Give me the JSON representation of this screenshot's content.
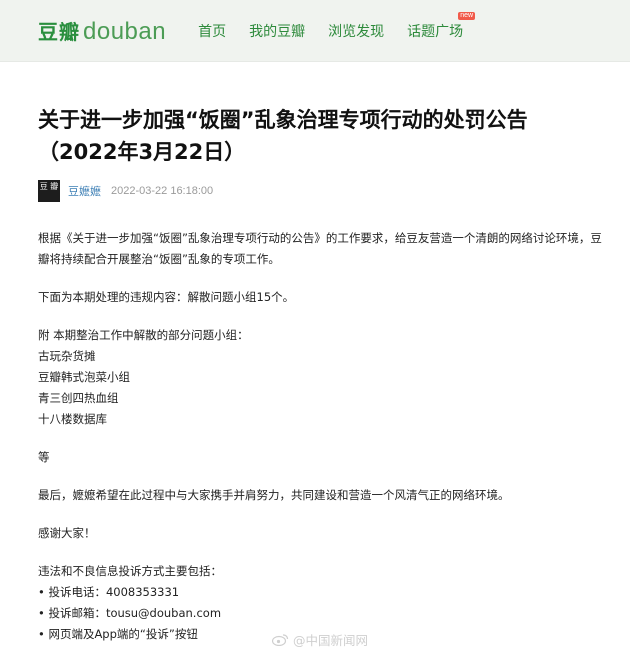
{
  "header": {
    "logo_cn": "豆瓣",
    "logo_en": "douban",
    "nav": [
      "首页",
      "我的豆瓣",
      "浏览发现",
      "话题广场"
    ],
    "badge": "new"
  },
  "article": {
    "title": "关于进一步加强“饭圈”乱象治理专项行动的处罚公告（2022年3月22日）",
    "avatar_text": "豆 瓣",
    "author": "豆嬷嬷",
    "time": "2022-03-22 16:18:00",
    "p1": "根据《关于进一步加强“饭圈”乱象治理专项行动的公告》的工作要求，给豆友营造一个清朗的网络讨论环境，豆瓣将持续配合开展整治“饭圈”乱象的专项工作。",
    "p2": "下面为本期处理的违规内容：解散问题小组15个。",
    "list_intro": "附 本期整治工作中解散的部分问题小组：",
    "groups": [
      "古玩杂货摊",
      "豆瓣韩式泡菜小组",
      "青三创四热血组",
      "十八楼数据库"
    ],
    "etc": "等",
    "p3": "最后，嬷嬷希望在此过程中与大家携手并肩努力，共同建设和营造一个风清气正的网络环境。",
    "thanks": "感谢大家！",
    "report_intro": "违法和不良信息投诉方式主要包括：",
    "report_items": [
      "• 投诉电话：4008353331",
      "• 投诉邮箱：tousu@douban.com",
      "• 网页端及App端的“投诉”按钮"
    ]
  },
  "watermark": "@中国新闻网"
}
